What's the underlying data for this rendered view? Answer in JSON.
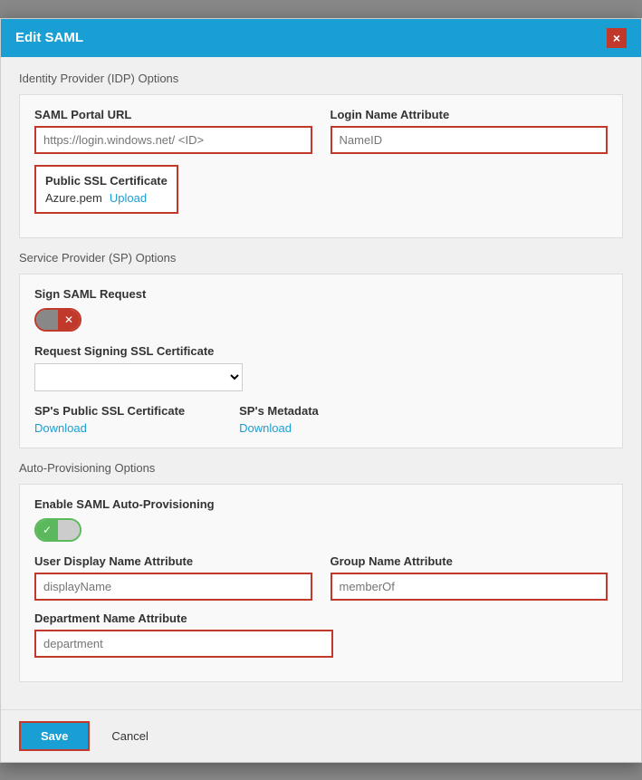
{
  "modal": {
    "title": "Edit SAML",
    "close_label": "×"
  },
  "idp_section": {
    "title": "Identity Provider (IDP) Options",
    "saml_url_label": "SAML Portal URL",
    "saml_url_placeholder": "https://login.windows.net/ <ID>",
    "login_name_label": "Login Name Attribute",
    "login_name_placeholder": "NameID",
    "ssl_cert_label": "Public SSL Certificate",
    "ssl_cert_filename": "Azure.pem",
    "upload_label": "Upload"
  },
  "sp_section": {
    "title": "Service Provider (SP) Options",
    "sign_saml_label": "Sign SAML Request",
    "request_signing_label": "Request Signing SSL Certificate",
    "sp_public_ssl_label": "SP's Public SSL Certificate",
    "sp_public_ssl_download": "Download",
    "sp_metadata_label": "SP's Metadata",
    "sp_metadata_download": "Download"
  },
  "auto_prov_section": {
    "title": "Auto-Provisioning Options",
    "enable_label": "Enable SAML Auto-Provisioning",
    "user_display_label": "User Display Name Attribute",
    "user_display_placeholder": "displayName",
    "group_name_label": "Group Name Attribute",
    "group_name_placeholder": "memberOf",
    "dept_name_label": "Department Name Attribute",
    "dept_name_placeholder": "department"
  },
  "footer": {
    "save_label": "Save",
    "cancel_label": "Cancel"
  }
}
